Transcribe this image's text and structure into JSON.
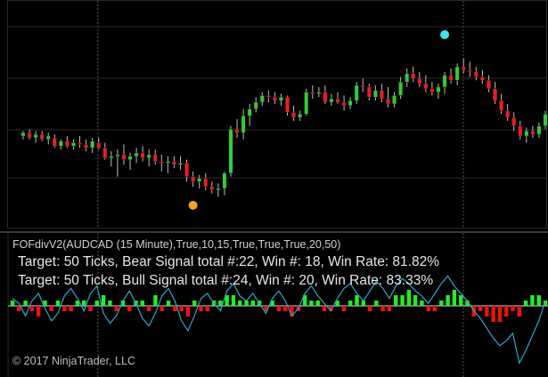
{
  "indicator": {
    "title": "FOFdivV2(AUDCAD (15 Minute),True,10,15,True,True,True,20,50)",
    "bear_line": "Target: 50 Ticks, Bear Signal total #:22, Win #: 18, Win Rate: 81.82%",
    "bull_line": "Target: 50 Ticks, Bull Signal total #:24, Win #: 20, Win Rate: 83.33%"
  },
  "footer": {
    "copyright": "© 2017 NinjaTrader, LLC"
  },
  "colors": {
    "background": "#000000",
    "up_candle": "#33cc33",
    "down_candle": "#ee1c1c",
    "wick": "#bfbfbf",
    "bull_bar": "#22ee22",
    "bear_bar": "#ee1111",
    "oscillator_line": "#2aa7c9",
    "bear_signal_dot": "#3ee6ee",
    "bull_signal_dot": "#f5a02a",
    "grid": "#2a2a2a"
  },
  "chart_data": {
    "type": "candlestick",
    "symbol": "AUDCAD",
    "timeframe": "15 Minute",
    "candles": [
      {
        "o": 5.0,
        "h": 5.3,
        "l": 4.8,
        "c": 5.2
      },
      {
        "o": 5.2,
        "h": 5.4,
        "l": 4.8,
        "c": 4.9
      },
      {
        "o": 4.9,
        "h": 5.3,
        "l": 4.6,
        "c": 5.1
      },
      {
        "o": 5.1,
        "h": 5.3,
        "l": 4.7,
        "c": 4.8
      },
      {
        "o": 4.8,
        "h": 5.2,
        "l": 4.5,
        "c": 5.0
      },
      {
        "o": 4.9,
        "h": 5.1,
        "l": 4.3,
        "c": 4.4
      },
      {
        "o": 4.4,
        "h": 4.8,
        "l": 4.2,
        "c": 4.7
      },
      {
        "o": 4.7,
        "h": 5.0,
        "l": 4.3,
        "c": 4.4
      },
      {
        "o": 4.4,
        "h": 4.8,
        "l": 4.2,
        "c": 4.6
      },
      {
        "o": 4.6,
        "h": 5.0,
        "l": 4.3,
        "c": 4.5
      },
      {
        "o": 4.5,
        "h": 4.8,
        "l": 4.1,
        "c": 4.3
      },
      {
        "o": 4.3,
        "h": 4.9,
        "l": 4.0,
        "c": 4.7
      },
      {
        "o": 4.6,
        "h": 4.9,
        "l": 4.2,
        "c": 4.3
      },
      {
        "o": 4.3,
        "h": 4.6,
        "l": 3.6,
        "c": 3.7
      },
      {
        "o": 3.7,
        "h": 4.1,
        "l": 3.2,
        "c": 3.8
      },
      {
        "o": 3.8,
        "h": 4.2,
        "l": 2.6,
        "c": 3.9
      },
      {
        "o": 3.9,
        "h": 4.5,
        "l": 3.3,
        "c": 3.6
      },
      {
        "o": 3.6,
        "h": 4.0,
        "l": 3.0,
        "c": 3.8
      },
      {
        "o": 3.8,
        "h": 4.3,
        "l": 3.4,
        "c": 4.0
      },
      {
        "o": 4.0,
        "h": 4.4,
        "l": 3.5,
        "c": 3.7
      },
      {
        "o": 3.7,
        "h": 4.2,
        "l": 3.2,
        "c": 3.9
      },
      {
        "o": 3.9,
        "h": 4.2,
        "l": 3.3,
        "c": 3.5
      },
      {
        "o": 3.5,
        "h": 3.9,
        "l": 2.9,
        "c": 3.4
      },
      {
        "o": 3.4,
        "h": 3.8,
        "l": 2.8,
        "c": 3.5
      },
      {
        "o": 3.5,
        "h": 3.8,
        "l": 3.1,
        "c": 3.3
      },
      {
        "o": 3.3,
        "h": 3.8,
        "l": 3.0,
        "c": 3.4
      },
      {
        "o": 3.4,
        "h": 3.6,
        "l": 2.3,
        "c": 2.6
      },
      {
        "o": 2.6,
        "h": 2.9,
        "l": 2.0,
        "c": 2.3
      },
      {
        "o": 2.3,
        "h": 2.7,
        "l": 1.9,
        "c": 2.5
      },
      {
        "o": 2.5,
        "h": 2.8,
        "l": 1.8,
        "c": 2.0
      },
      {
        "o": 2.0,
        "h": 2.3,
        "l": 1.6,
        "c": 1.8
      },
      {
        "o": 1.8,
        "h": 2.2,
        "l": 1.4,
        "c": 1.9
      },
      {
        "o": 1.9,
        "h": 2.9,
        "l": 1.5,
        "c": 2.8
      },
      {
        "o": 2.8,
        "h": 5.6,
        "l": 2.6,
        "c": 5.4
      },
      {
        "o": 5.4,
        "h": 6.0,
        "l": 4.9,
        "c": 5.2
      },
      {
        "o": 5.2,
        "h": 6.6,
        "l": 4.8,
        "c": 6.2
      },
      {
        "o": 6.2,
        "h": 6.9,
        "l": 5.6,
        "c": 6.6
      },
      {
        "o": 6.6,
        "h": 7.3,
        "l": 6.4,
        "c": 7.0
      },
      {
        "o": 7.0,
        "h": 7.6,
        "l": 6.8,
        "c": 7.4
      },
      {
        "o": 7.4,
        "h": 7.7,
        "l": 7.0,
        "c": 7.3
      },
      {
        "o": 7.3,
        "h": 7.6,
        "l": 6.9,
        "c": 7.1
      },
      {
        "o": 7.1,
        "h": 7.5,
        "l": 6.8,
        "c": 7.3
      },
      {
        "o": 7.3,
        "h": 7.4,
        "l": 6.2,
        "c": 6.4
      },
      {
        "o": 6.4,
        "h": 6.8,
        "l": 5.9,
        "c": 6.1
      },
      {
        "o": 6.1,
        "h": 6.5,
        "l": 5.9,
        "c": 6.3
      },
      {
        "o": 6.3,
        "h": 7.8,
        "l": 6.2,
        "c": 7.6
      },
      {
        "o": 7.6,
        "h": 8.0,
        "l": 7.2,
        "c": 7.5
      },
      {
        "o": 7.5,
        "h": 7.9,
        "l": 7.3,
        "c": 7.6
      },
      {
        "o": 7.6,
        "h": 8.0,
        "l": 6.9,
        "c": 7.0
      },
      {
        "o": 7.0,
        "h": 7.5,
        "l": 6.8,
        "c": 7.2
      },
      {
        "o": 7.2,
        "h": 7.6,
        "l": 6.9,
        "c": 7.0
      },
      {
        "o": 7.0,
        "h": 7.4,
        "l": 6.5,
        "c": 6.8
      },
      {
        "o": 6.8,
        "h": 7.3,
        "l": 6.6,
        "c": 7.1
      },
      {
        "o": 7.1,
        "h": 8.2,
        "l": 6.9,
        "c": 8.0
      },
      {
        "o": 8.0,
        "h": 8.4,
        "l": 7.6,
        "c": 7.9
      },
      {
        "o": 7.9,
        "h": 8.1,
        "l": 7.1,
        "c": 7.3
      },
      {
        "o": 7.3,
        "h": 8.0,
        "l": 7.1,
        "c": 7.7
      },
      {
        "o": 7.7,
        "h": 8.1,
        "l": 7.0,
        "c": 7.2
      },
      {
        "o": 7.2,
        "h": 7.9,
        "l": 6.7,
        "c": 6.9
      },
      {
        "o": 6.9,
        "h": 7.6,
        "l": 6.7,
        "c": 7.4
      },
      {
        "o": 7.4,
        "h": 8.5,
        "l": 7.2,
        "c": 8.2
      },
      {
        "o": 8.2,
        "h": 9.0,
        "l": 7.9,
        "c": 8.7
      },
      {
        "o": 8.7,
        "h": 9.1,
        "l": 8.2,
        "c": 8.4
      },
      {
        "o": 8.4,
        "h": 8.8,
        "l": 7.9,
        "c": 8.1
      },
      {
        "o": 8.1,
        "h": 8.6,
        "l": 7.6,
        "c": 7.8
      },
      {
        "o": 7.8,
        "h": 8.2,
        "l": 7.4,
        "c": 7.6
      },
      {
        "o": 7.6,
        "h": 8.1,
        "l": 7.2,
        "c": 7.9
      },
      {
        "o": 7.9,
        "h": 8.8,
        "l": 7.5,
        "c": 8.6
      },
      {
        "o": 8.6,
        "h": 9.0,
        "l": 8.1,
        "c": 8.3
      },
      {
        "o": 8.3,
        "h": 9.3,
        "l": 8.0,
        "c": 9.1
      },
      {
        "o": 9.1,
        "h": 9.6,
        "l": 8.7,
        "c": 8.9
      },
      {
        "o": 8.9,
        "h": 9.4,
        "l": 8.5,
        "c": 8.8
      },
      {
        "o": 8.8,
        "h": 9.1,
        "l": 8.3,
        "c": 8.5
      },
      {
        "o": 8.5,
        "h": 8.9,
        "l": 8.1,
        "c": 8.3
      },
      {
        "o": 8.3,
        "h": 8.6,
        "l": 7.6,
        "c": 7.8
      },
      {
        "o": 7.8,
        "h": 8.2,
        "l": 6.9,
        "c": 7.1
      },
      {
        "o": 7.1,
        "h": 7.5,
        "l": 6.3,
        "c": 6.5
      },
      {
        "o": 6.5,
        "h": 6.9,
        "l": 5.9,
        "c": 6.1
      },
      {
        "o": 6.1,
        "h": 6.4,
        "l": 5.3,
        "c": 5.6
      },
      {
        "o": 5.6,
        "h": 5.9,
        "l": 4.8,
        "c": 5.0
      },
      {
        "o": 5.0,
        "h": 5.5,
        "l": 4.6,
        "c": 5.3
      },
      {
        "o": 5.3,
        "h": 5.6,
        "l": 4.9,
        "c": 5.1
      },
      {
        "o": 5.1,
        "h": 5.8,
        "l": 4.9,
        "c": 5.6
      },
      {
        "o": 5.6,
        "h": 6.5,
        "l": 5.4,
        "c": 6.3
      }
    ],
    "signals": [
      {
        "type": "bear",
        "index": 67,
        "price": 11.0
      },
      {
        "type": "bull",
        "index": 27,
        "price": 0.9
      }
    ],
    "histogram": [
      1,
      -1,
      1,
      -1,
      -2,
      1,
      -1,
      1,
      -1,
      -1,
      1,
      1,
      -1,
      1,
      2,
      1,
      -1,
      1,
      -1,
      1,
      1,
      -1,
      2,
      -1,
      1,
      -1,
      -1,
      -2,
      1,
      -1,
      -1,
      1,
      1,
      2,
      2,
      1,
      1,
      1,
      1,
      -1,
      1,
      -1,
      -1,
      -2,
      -1,
      2,
      1,
      1,
      -1,
      -1,
      1,
      -1,
      1,
      2,
      1,
      -1,
      1,
      -1,
      -1,
      2,
      2,
      3,
      2,
      1,
      -1,
      -1,
      1,
      2,
      3,
      2,
      1,
      -2,
      -1,
      -2,
      -3,
      -3,
      -2,
      -1,
      -2,
      1,
      2,
      2,
      1
    ],
    "oscillator": [
      0.3,
      0.1,
      -0.4,
      0.2,
      0.5,
      -0.1,
      -0.6,
      -0.3,
      0.4,
      0.7,
      0.3,
      -0.2,
      0.5,
      0.8,
      -0.3,
      -0.7,
      -0.4,
      0.2,
      0.6,
      0.1,
      -0.5,
      -0.8,
      -0.3,
      0.4,
      0.7,
      0.2,
      -0.6,
      -1.0,
      -0.4,
      0.3,
      0.5,
      0.1,
      -0.2,
      0.6,
      0.9,
      0.4,
      0.2,
      0.5,
      0.1,
      -0.3,
      0.3,
      0.6,
      0.2,
      -0.4,
      -0.1,
      0.5,
      0.8,
      0.4,
      0.1,
      -0.2,
      0.3,
      0.7,
      0.9,
      0.5,
      0.2,
      0.6,
      1.0,
      0.7,
      0.3,
      0.8,
      1.1,
      0.9,
      0.6,
      0.4,
      0.1,
      0.5,
      0.9,
      1.2,
      0.8,
      0.5,
      0.2,
      -0.2,
      -0.5,
      -0.9,
      -1.3,
      -1.6,
      -1.4,
      -1.1,
      -2.3,
      -1.8,
      -1.2,
      -0.6,
      0.2
    ]
  }
}
